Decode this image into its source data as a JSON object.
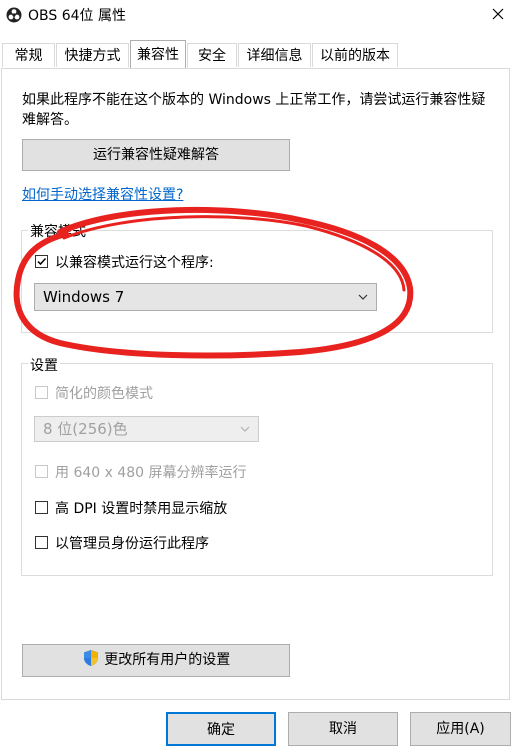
{
  "window": {
    "title": "OBS 64位 属性"
  },
  "tabs": [
    {
      "label": "常规"
    },
    {
      "label": "快捷方式"
    },
    {
      "label": "兼容性"
    },
    {
      "label": "安全"
    },
    {
      "label": "详细信息"
    },
    {
      "label": "以前的版本"
    }
  ],
  "intro": {
    "text": "如果此程序不能在这个版本的 Windows 上正常工作，请尝试运行兼容性疑难解答。"
  },
  "troubleshoot_button": "运行兼容性疑难解答",
  "manual_link": "如何手动选择兼容性设置?",
  "compat_mode": {
    "legend": "兼容模式",
    "checkbox_label": "以兼容模式运行这个程序:",
    "checked": true,
    "selected_os": "Windows 7"
  },
  "settings": {
    "legend": "设置",
    "reduced_color_label": "简化的颜色模式",
    "color_depth": "8 位(256)色",
    "resolution_label": "用 640 x 480 屏幕分辨率运行",
    "dpi_label": "高 DPI 设置时禁用显示缩放",
    "admin_label": "以管理员身份运行此程序"
  },
  "change_all_button": "更改所有用户的设置",
  "footer": {
    "ok": "确定",
    "cancel": "取消",
    "apply": "应用(A)"
  },
  "colors": {
    "accent": "#0078d7",
    "link": "#0066cc",
    "annotation": "#e8231f"
  }
}
